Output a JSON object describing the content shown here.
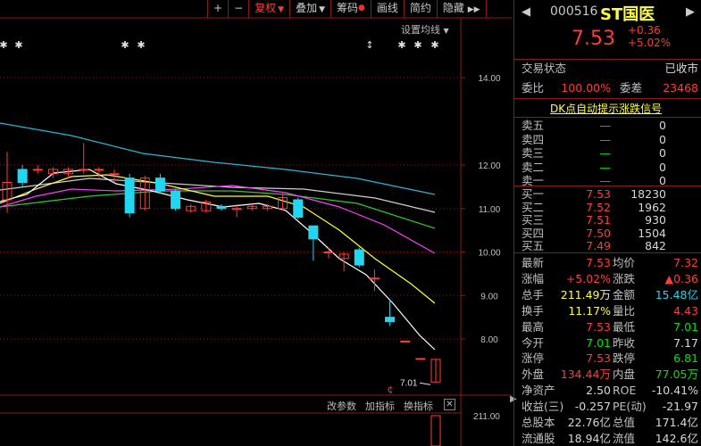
{
  "toolbar": {
    "items": [
      {
        "label": "+"
      },
      {
        "label": "−"
      },
      {
        "label": "复权"
      },
      {
        "label": "叠加"
      },
      {
        "label": "筹码"
      },
      {
        "label": "画线"
      },
      {
        "label": "简约"
      },
      {
        "label": "隐藏"
      }
    ],
    "expand": "▶▶"
  },
  "settings_ma": "设置均线",
  "price_axis": [
    "14.00",
    "12.00",
    "11.00",
    "10.00",
    "9.00",
    "8.00"
  ],
  "low_label": "7.01",
  "volume_axis_label": "211.00",
  "event_marker": "¢",
  "panel_tabs": {
    "change": "改参数",
    "add": "加指标",
    "switch": "换指标",
    "close": "✕"
  },
  "stock": {
    "code": "000516",
    "name": "ST国医",
    "price": "7.53",
    "change": "+0.36",
    "change_pct": "+5.02%",
    "nav_prev": "◀",
    "nav_next": "▶"
  },
  "status": {
    "label": "交易状态",
    "value": "已收市"
  },
  "weibi": {
    "label": "委比",
    "value": "100.00%"
  },
  "weicha": {
    "label": "委差",
    "value": "23468"
  },
  "dk_signal": "DK点自动提示涨跌信号",
  "sells": [
    {
      "label": "卖五",
      "price": "—",
      "vol": "0"
    },
    {
      "label": "卖四",
      "price": "—",
      "vol": "0"
    },
    {
      "label": "卖三",
      "price": "—",
      "vol": "0"
    },
    {
      "label": "卖二",
      "price": "—",
      "vol": "0"
    },
    {
      "label": "卖一",
      "price": "—",
      "vol": "0"
    }
  ],
  "buys": [
    {
      "label": "买一",
      "price": "7.53",
      "vol": "18230"
    },
    {
      "label": "买二",
      "price": "7.52",
      "vol": "1962"
    },
    {
      "label": "买三",
      "price": "7.51",
      "vol": "930"
    },
    {
      "label": "买四",
      "price": "7.50",
      "vol": "1504"
    },
    {
      "label": "买五",
      "price": "7.49",
      "vol": "842"
    }
  ],
  "stats": [
    {
      "l1": "最新",
      "v1": "7.53",
      "c1": "red",
      "l2": "均价",
      "v2": "7.32",
      "c2": "red"
    },
    {
      "l1": "涨幅",
      "v1": "+5.02%",
      "c1": "red",
      "l2": "涨跌",
      "v2": "▲0.36",
      "c2": "red"
    },
    {
      "l1": "总手",
      "v1": "211.49万",
      "c1": "yel",
      "l2": "金额",
      "v2": "15.48亿",
      "c2": "cyan"
    },
    {
      "l1": "换手",
      "v1": "11.17%",
      "c1": "yel",
      "l2": "量比",
      "v2": "4.43",
      "c2": "red"
    },
    {
      "l1": "最高",
      "v1": "7.53",
      "c1": "red",
      "l2": "最低",
      "v2": "7.01",
      "c2": "green"
    },
    {
      "l1": "今开",
      "v1": "7.01",
      "c1": "green",
      "l2": "昨收",
      "v2": "7.17",
      "c2": "wht"
    },
    {
      "l1": "涨停",
      "v1": "7.53",
      "c1": "red",
      "l2": "跌停",
      "v2": "6.81",
      "c2": "green"
    },
    {
      "l1": "外盘",
      "v1": "134.44万",
      "c1": "red",
      "l2": "内盘",
      "v2": "77.05万",
      "c2": "green"
    },
    {
      "l1": "净资产",
      "v1": "2.50",
      "c1": "wht",
      "l2": "ROE",
      "v2": "-10.41%",
      "c2": "wht"
    },
    {
      "l1": "收益(三)",
      "v1": "-0.257",
      "c1": "wht",
      "l2": "PE(动)",
      "v2": "-21.97",
      "c2": "wht"
    },
    {
      "l1": "总股本",
      "v1": "22.76亿",
      "c1": "wht",
      "l2": "总值",
      "v2": "171.4亿",
      "c2": "wht"
    },
    {
      "l1": "流通股",
      "v1": "18.94亿",
      "c1": "wht",
      "l2": "流值",
      "v2": "142.6亿",
      "c2": "wht"
    }
  ],
  "colors": {
    "up": "#ff3b3b",
    "down": "#22d6f0",
    "ma5": "#ffffff",
    "ma10": "#ffff3c",
    "ma20": "#ff3cff",
    "ma30": "#2ccc2c",
    "ma60": "#cfcfcf",
    "ma120": "#22b8d8",
    "grid": "#8b1a1a"
  },
  "chart_data": {
    "type": "candlestick",
    "y_axis_ticks": [
      14.0,
      12.0,
      11.0,
      10.0,
      9.0,
      8.0
    ],
    "candles": [
      {
        "open": 11.2,
        "close": 11.6,
        "high": 12.3,
        "low": 10.9
      },
      {
        "open": 11.9,
        "close": 11.6,
        "high": 12.0,
        "low": 11.5
      },
      {
        "open": 11.9,
        "close": 11.9,
        "high": 12.0,
        "low": 11.8
      },
      {
        "open": 11.8,
        "close": 11.9,
        "high": 11.95,
        "low": 11.7
      },
      {
        "open": 11.8,
        "close": 11.9,
        "high": 11.95,
        "low": 11.7
      },
      {
        "open": 11.9,
        "close": 11.9,
        "high": 12.5,
        "low": 11.8
      },
      {
        "open": 11.9,
        "close": 11.9,
        "high": 11.95,
        "low": 11.7
      },
      {
        "open": 11.8,
        "close": 11.8,
        "high": 11.9,
        "low": 11.6
      },
      {
        "open": 11.7,
        "close": 10.9,
        "high": 11.8,
        "low": 10.8
      },
      {
        "open": 11.0,
        "close": 11.7,
        "high": 11.75,
        "low": 10.95
      },
      {
        "open": 11.7,
        "close": 11.4,
        "high": 11.8,
        "low": 11.35
      },
      {
        "open": 11.4,
        "close": 11.0,
        "high": 11.45,
        "low": 10.95
      },
      {
        "open": 10.95,
        "close": 11.05,
        "high": 11.1,
        "low": 10.9
      },
      {
        "open": 10.95,
        "close": 11.15,
        "high": 11.2,
        "low": 10.9
      },
      {
        "open": 11.05,
        "close": 11.0,
        "high": 11.1,
        "low": 10.95
      },
      {
        "open": 11.0,
        "close": 11.0,
        "high": 11.1,
        "low": 10.8
      },
      {
        "open": 11.0,
        "close": 11.05,
        "high": 11.1,
        "low": 10.95
      },
      {
        "open": 11.0,
        "close": 11.05,
        "high": 11.1,
        "low": 10.95
      },
      {
        "open": 11.0,
        "close": 11.25,
        "high": 11.35,
        "low": 10.95
      },
      {
        "open": 11.2,
        "close": 10.8,
        "high": 11.25,
        "low": 10.75
      },
      {
        "open": 10.6,
        "close": 10.3,
        "high": 10.6,
        "low": 9.8
      },
      {
        "open": 10.0,
        "close": 10.0,
        "high": 10.1,
        "low": 9.85
      },
      {
        "open": 9.85,
        "close": 9.95,
        "high": 10.0,
        "low": 9.55
      },
      {
        "open": 10.05,
        "close": 9.7,
        "high": 10.1,
        "low": 9.65
      },
      {
        "open": 9.4,
        "close": 9.4,
        "high": 9.6,
        "low": 9.1
      },
      {
        "open": 8.5,
        "close": 8.4,
        "high": 8.9,
        "low": 8.3
      },
      {
        "open": 7.95,
        "close": 7.95,
        "high": 7.95,
        "low": 7.95
      },
      {
        "open": 7.55,
        "close": 7.55,
        "high": 7.55,
        "low": 7.55
      },
      {
        "open": 7.01,
        "close": 7.53,
        "high": 7.53,
        "low": 7.01
      }
    ],
    "volumes": [
      20,
      18,
      15,
      15,
      14,
      16,
      14,
      14,
      25,
      20,
      16,
      14,
      12,
      12,
      12,
      12,
      12,
      12,
      14,
      22,
      25,
      18,
      16,
      15,
      18,
      22,
      10,
      10,
      211
    ]
  }
}
